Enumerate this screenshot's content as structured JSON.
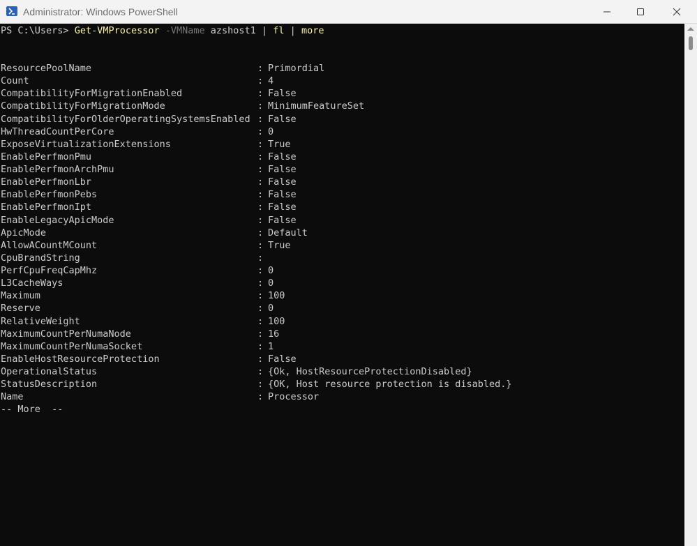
{
  "window": {
    "title": "Administrator: Windows PowerShell",
    "icon": "powershell-icon",
    "controls": [
      "minimize-icon",
      "maximize-icon",
      "close-icon"
    ]
  },
  "console": {
    "prompt": "PS C:\\Users>",
    "command": {
      "cmdlet": "Get-VMProcessor",
      "parameter": "-VMName",
      "argument": "azshost1",
      "pipe1": "|",
      "format": "fl",
      "pipe2": "|",
      "pager": "more"
    },
    "properties": [
      {
        "name": "ResourcePoolName",
        "value": "Primordial"
      },
      {
        "name": "Count",
        "value": "4"
      },
      {
        "name": "CompatibilityForMigrationEnabled",
        "value": "False"
      },
      {
        "name": "CompatibilityForMigrationMode",
        "value": "MinimumFeatureSet"
      },
      {
        "name": "CompatibilityForOlderOperatingSystemsEnabled",
        "value": "False"
      },
      {
        "name": "HwThreadCountPerCore",
        "value": "0"
      },
      {
        "name": "ExposeVirtualizationExtensions",
        "value": "True"
      },
      {
        "name": "EnablePerfmonPmu",
        "value": "False"
      },
      {
        "name": "EnablePerfmonArchPmu",
        "value": "False"
      },
      {
        "name": "EnablePerfmonLbr",
        "value": "False"
      },
      {
        "name": "EnablePerfmonPebs",
        "value": "False"
      },
      {
        "name": "EnablePerfmonIpt",
        "value": "False"
      },
      {
        "name": "EnableLegacyApicMode",
        "value": "False"
      },
      {
        "name": "ApicMode",
        "value": "Default"
      },
      {
        "name": "AllowACountMCount",
        "value": "True"
      },
      {
        "name": "CpuBrandString",
        "value": ""
      },
      {
        "name": "PerfCpuFreqCapMhz",
        "value": "0"
      },
      {
        "name": "L3CacheWays",
        "value": "0"
      },
      {
        "name": "Maximum",
        "value": "100"
      },
      {
        "name": "Reserve",
        "value": "0"
      },
      {
        "name": "RelativeWeight",
        "value": "100"
      },
      {
        "name": "MaximumCountPerNumaNode",
        "value": "16"
      },
      {
        "name": "MaximumCountPerNumaSocket",
        "value": "1"
      },
      {
        "name": "EnableHostResourceProtection",
        "value": "False"
      },
      {
        "name": "OperationalStatus",
        "value": "{Ok, HostResourceProtectionDisabled}"
      },
      {
        "name": "StatusDescription",
        "value": "{OK, Host resource protection is disabled.}"
      },
      {
        "name": "Name",
        "value": "Processor"
      }
    ],
    "separator": ":",
    "more_prompt": "-- More  --"
  },
  "colors": {
    "background": "#0c0c0c",
    "text": "#cccccc",
    "cmdlet": "#f9f1a5",
    "parameter": "#767676",
    "titlebar": "#f3f3f3"
  }
}
